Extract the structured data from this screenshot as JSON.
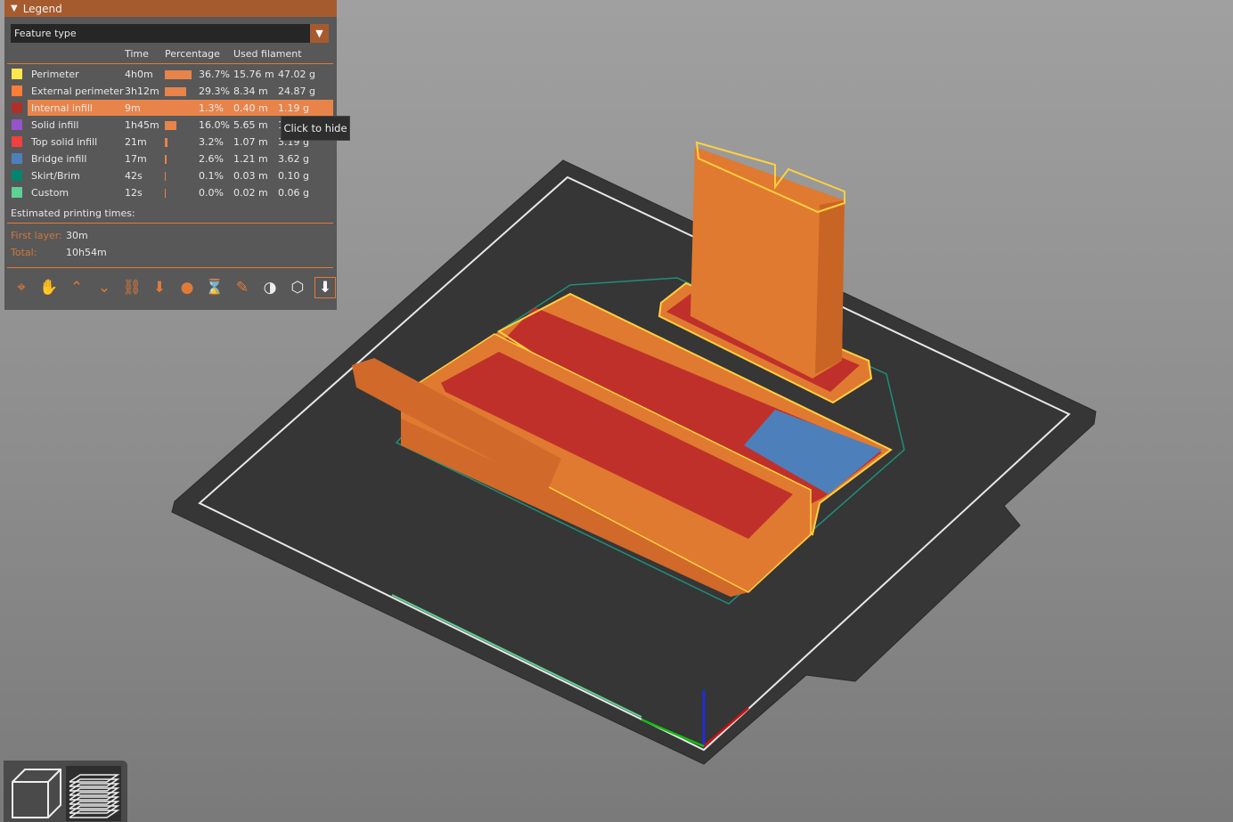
{
  "legend": {
    "title": "Legend",
    "view_type": "Feature type",
    "columns": {
      "time": "Time",
      "percentage": "Percentage",
      "used_filament": "Used filament"
    },
    "rows": [
      {
        "name": "Perimeter",
        "color": "#FFE64D",
        "time": "4h0m",
        "percent": "36.7%",
        "percent_value": 36.7,
        "length": "15.76 m",
        "weight": "47.02 g"
      },
      {
        "name": "External perimeter",
        "color": "#FF7D38",
        "time": "3h12m",
        "percent": "29.3%",
        "percent_value": 29.3,
        "length": "8.34 m",
        "weight": "24.87 g"
      },
      {
        "name": "Internal infill",
        "color": "#B03029",
        "time": "9m",
        "percent": "1.3%",
        "percent_value": 1.3,
        "length": "0.40 m",
        "weight": "1.19 g"
      },
      {
        "name": "Solid infill",
        "color": "#9654CC",
        "time": "1h45m",
        "percent": "16.0%",
        "percent_value": 16.0,
        "length": "5.65 m",
        "weight": "16.84 g"
      },
      {
        "name": "Top solid infill",
        "color": "#F04040",
        "time": "21m",
        "percent": "3.2%",
        "percent_value": 3.2,
        "length": "1.07 m",
        "weight": "3.19 g"
      },
      {
        "name": "Bridge infill",
        "color": "#4D80BA",
        "time": "17m",
        "percent": "2.6%",
        "percent_value": 2.6,
        "length": "1.21 m",
        "weight": "3.62 g"
      },
      {
        "name": "Skirt/Brim",
        "color": "#00876E",
        "time": "42s",
        "percent": "0.1%",
        "percent_value": 0.1,
        "length": "0.03 m",
        "weight": "0.10 g"
      },
      {
        "name": "Custom",
        "color": "#5ED194",
        "time": "12s",
        "percent": "0.0%",
        "percent_value": 0.0,
        "length": "0.02 m",
        "weight": "0.06 g"
      }
    ],
    "highlighted_row": "Internal infill",
    "tooltip": "Click to hide",
    "estimated_label": "Estimated printing times:",
    "first_layer_label": "First layer:",
    "first_layer": "30m",
    "total_label": "Total:",
    "total": "10h54m",
    "toolbar_icons": [
      "travel-icon",
      "wipe-icon",
      "retractions-icon",
      "deretractions-icon",
      "seams-icon",
      "tool-changes-icon",
      "color-changes-icon",
      "pause-prints-icon",
      "custom-gcode-icon",
      "center-of-gravity-icon",
      "shells-icon",
      "tool-marker-icon"
    ]
  },
  "view_buttons": [
    "3d-view-icon",
    "layers-view-icon"
  ]
}
